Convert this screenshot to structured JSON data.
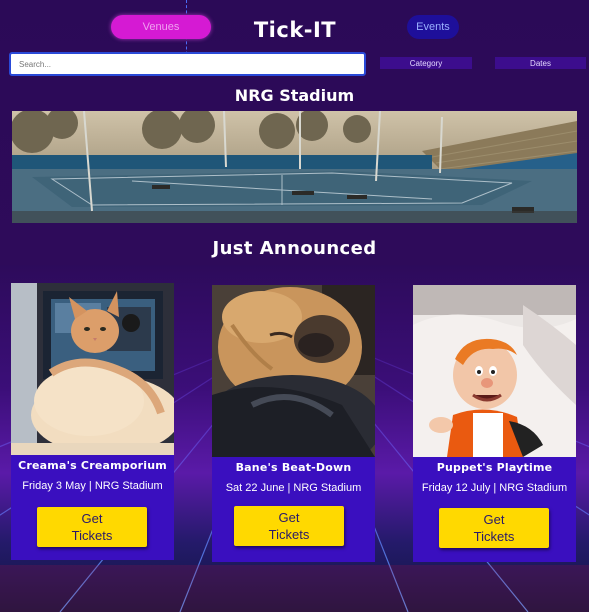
{
  "header": {
    "venues_label": "Venues",
    "brand": "Tick-IT",
    "events_label": "Events"
  },
  "search": {
    "placeholder": "Search..."
  },
  "filters": {
    "category_label": "Category",
    "dates_label": "Dates"
  },
  "venue": {
    "name": "NRG Stadium"
  },
  "section": {
    "title": "Just Announced"
  },
  "events": [
    {
      "name": "Creama's Creamporium",
      "date": "Friday 3 May | NRG Stadium",
      "button": "Get Tickets"
    },
    {
      "name": "Bane's Beat-Down",
      "date": "Sat 22 June | NRG Stadium",
      "button": "Get Tickets"
    },
    {
      "name": "Puppet's Playtime",
      "date": "Friday 12 July | NRG Stadium",
      "button": "Get Tickets"
    }
  ],
  "colors": {
    "background": "#2a0b55",
    "venues_button": "#d51ad3",
    "events_button": "#1e0f9a",
    "card": "#3a0fbf",
    "ticket_button": "#ffd900"
  }
}
